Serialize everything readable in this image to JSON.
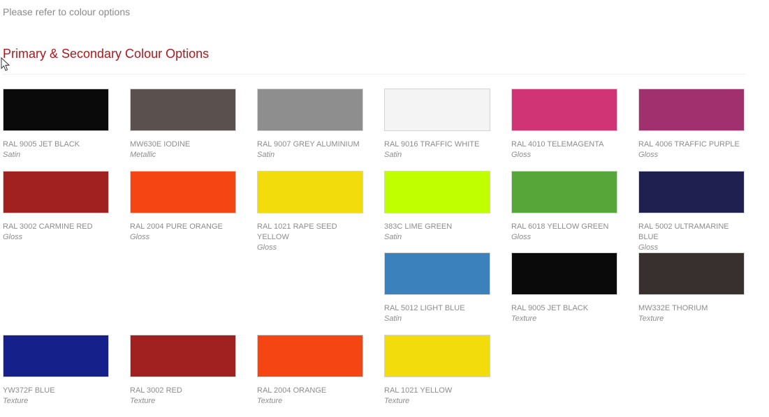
{
  "intro_text": "Please refer to colour options",
  "heading": "Primary & Secondary Colour Options",
  "swatches": [
    {
      "name": "RAL 9005 JET BLACK",
      "finish": "Satin",
      "color": "#0a0a0a"
    },
    {
      "name": "MW630E IODINE",
      "finish": "Metallic",
      "color": "#5a504d"
    },
    {
      "name": "RAL 9007 GREY ALUMINIUM",
      "finish": "Satin",
      "color": "#8e8e8e"
    },
    {
      "name": "RAL 9016 TRAFFIC WHITE",
      "finish": "Satin",
      "color": "#f4f4f4"
    },
    {
      "name": "RAL 4010 TELEMAGENTA",
      "finish": "Gloss",
      "color": "#d13474"
    },
    {
      "name": "RAL 4006 TRAFFIC PURPLE",
      "finish": "Gloss",
      "color": "#a0306e"
    },
    {
      "name": "RAL 3002 CARMINE RED",
      "finish": "Gloss",
      "color": "#a0211f"
    },
    {
      "name": "RAL 2004 PURE ORANGE",
      "finish": "Gloss",
      "color": "#f44512"
    },
    {
      "name": "RAL 1021 RAPE SEED YELLOW",
      "finish": "Gloss",
      "color": "#f2dc0c"
    },
    {
      "name": "383C LIME GREEN",
      "finish": "Satin",
      "color": "#bfff00"
    },
    {
      "name": "RAL 6018 YELLOW GREEN",
      "finish": "Gloss",
      "color": "#57a63a"
    },
    {
      "name": "RAL 5002 ULTRAMARINE BLUE",
      "finish": "Gloss",
      "color": "#1f1f50"
    },
    {
      "name": "RAL 5012 LIGHT BLUE",
      "finish": "Satin",
      "color": "#3b81bb"
    },
    {
      "name": "RAL 9005 JET BLACK",
      "finish": "Texture",
      "color": "#0a0a0a"
    },
    {
      "name": "MW332E THORIUM",
      "finish": "Texture",
      "color": "#37302f"
    },
    {
      "name": "YW372F BLUE",
      "finish": "Texture",
      "color": "#15208a"
    },
    {
      "name": "RAL 3002 RED",
      "finish": "Texture",
      "color": "#a0211f"
    },
    {
      "name": "RAL 2004 ORANGE",
      "finish": "Texture",
      "color": "#f44512"
    },
    {
      "name": "RAL 1021 YELLOW",
      "finish": "Texture",
      "color": "#f2dc0c"
    }
  ]
}
